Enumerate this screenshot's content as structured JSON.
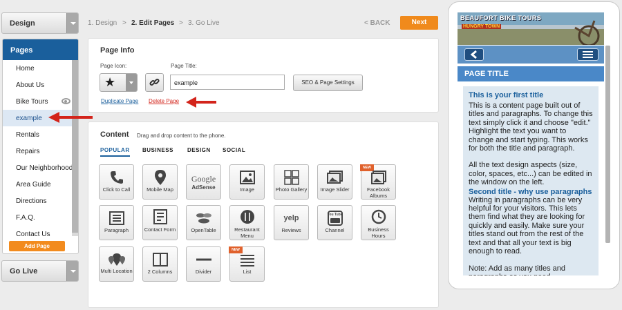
{
  "sidebar": {
    "design_label": "Design",
    "pages_title": "Pages",
    "pages": [
      {
        "label": "Home"
      },
      {
        "label": "About Us"
      },
      {
        "label": "Bike Tours"
      },
      {
        "label": "example"
      },
      {
        "label": "Rentals"
      },
      {
        "label": "Repairs"
      },
      {
        "label": "Our Neighborhood"
      },
      {
        "label": "Area Guide"
      },
      {
        "label": "Directions"
      },
      {
        "label": "F.A.Q."
      },
      {
        "label": "Contact Us"
      }
    ],
    "add_page_label": "Add Page",
    "golive_label": "Go Live"
  },
  "steps": {
    "s1": "1. Design",
    "s2": "2. Edit Pages",
    "s3": "3. Go Live",
    "sep": ">",
    "back": "< BACK",
    "next": "Next"
  },
  "page_info": {
    "title": "Page Info",
    "icon_label": "Page Icon:",
    "title_label": "Page Title:",
    "title_value": "example",
    "seo_label": "SEO & Page Settings",
    "duplicate": "Duplicate Page",
    "delete": "Delete Page"
  },
  "content": {
    "title": "Content",
    "subtitle": "Drag and drop content to the phone.",
    "tabs": [
      "POPULAR",
      "BUSINESS",
      "DESIGN",
      "SOCIAL"
    ],
    "new_badge": "NEW",
    "tiles": [
      {
        "label": "Click to Call",
        "icon": "phone-icon"
      },
      {
        "label": "Mobile Map",
        "icon": "map-pin-icon"
      },
      {
        "label": "AdSense",
        "icon": "google-adsense-icon",
        "logo": "Google"
      },
      {
        "label": "Image",
        "icon": "image-icon"
      },
      {
        "label": "Photo Gallery",
        "icon": "photo-gallery-icon"
      },
      {
        "label": "Image Slider",
        "icon": "image-slider-icon"
      },
      {
        "label": "Facebook Albums",
        "icon": "facebook-albums-icon"
      },
      {
        "label": "Paragraph",
        "icon": "paragraph-icon"
      },
      {
        "label": "Contact Form",
        "icon": "contact-form-icon"
      },
      {
        "label": "OpenTable",
        "icon": "opentable-icon"
      },
      {
        "label": "Restaurant Menu",
        "icon": "restaurant-menu-icon"
      },
      {
        "label": "Reviews",
        "icon": "yelp-icon",
        "logo": "yelp"
      },
      {
        "label": "Channel",
        "icon": "youtube-icon",
        "logo": "You Tube"
      },
      {
        "label": "Business Hours",
        "icon": "clock-icon"
      },
      {
        "label": "Multi Location",
        "icon": "multi-location-icon"
      },
      {
        "label": "2 Columns",
        "icon": "two-columns-icon"
      },
      {
        "label": "Divider",
        "icon": "divider-icon"
      },
      {
        "label": "List",
        "icon": "list-icon"
      }
    ]
  },
  "phone": {
    "brand": "BEAUFORT BIKE TOURS",
    "banner": "HUNGRY TOWN",
    "page_title": "PAGE TITLE",
    "heading1": "This is your first title",
    "para1": "This is a content page built out of titles and paragraphs. To change this text simply click it and choose \"edit.\" Highlight the text you want to change and start typing. This works for both the title and paragraph.",
    "para2": "All the text design aspects (size, color, spaces, etc...) can be edited in the window on the left.",
    "heading2": "Second title - why use paragraphs",
    "para3": "Writing in paragraphs can be very helpful for your visitors. This lets them find what they are looking for quickly and easily. Make sure your titles stand out from the rest of the text and that all your text is big enough to read.",
    "para4": "Note: Add as many titles and paragraphs as you need."
  },
  "colors": {
    "brand_blue": "#1a5f9c",
    "accent_orange": "#f08a1c",
    "arrow_red": "#d3241b"
  }
}
